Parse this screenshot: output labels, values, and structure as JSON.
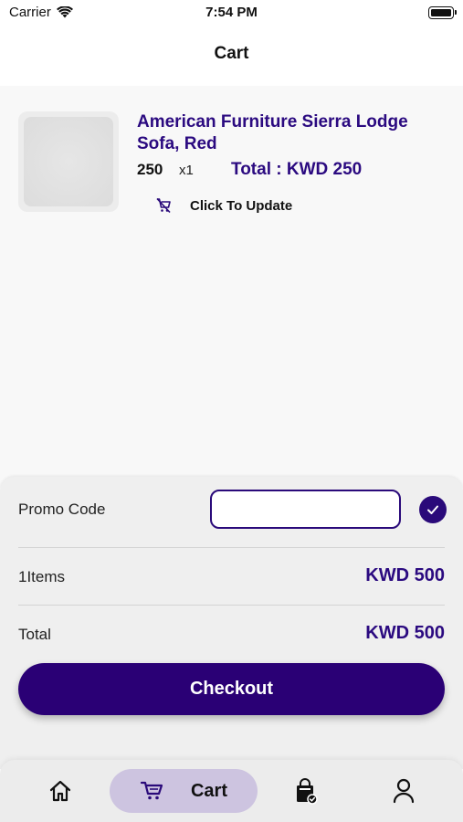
{
  "status_bar": {
    "carrier": "Carrier",
    "time": "7:54 PM"
  },
  "header": {
    "title": "Cart"
  },
  "cart_item": {
    "name": "American Furniture Sierra Lodge Sofa, Red",
    "price": "250",
    "quantity": "x1",
    "total": "Total : KWD 250",
    "update_label": "Click To Update"
  },
  "summary": {
    "promo_label": "Promo Code",
    "promo_value": "",
    "items_label": "1Items",
    "items_value": "KWD 500",
    "total_label": "Total",
    "total_value": "KWD 500",
    "checkout_label": "Checkout"
  },
  "tabbar": {
    "items": [
      {
        "icon": "home-icon"
      },
      {
        "icon": "cart-icon",
        "label": "Cart"
      },
      {
        "icon": "orders-bag-icon"
      },
      {
        "icon": "profile-icon"
      }
    ]
  },
  "colors": {
    "accent": "#2a0a7a",
    "accent_text": "#2b0a80",
    "active_tab_bg": "#cdc4e0"
  }
}
